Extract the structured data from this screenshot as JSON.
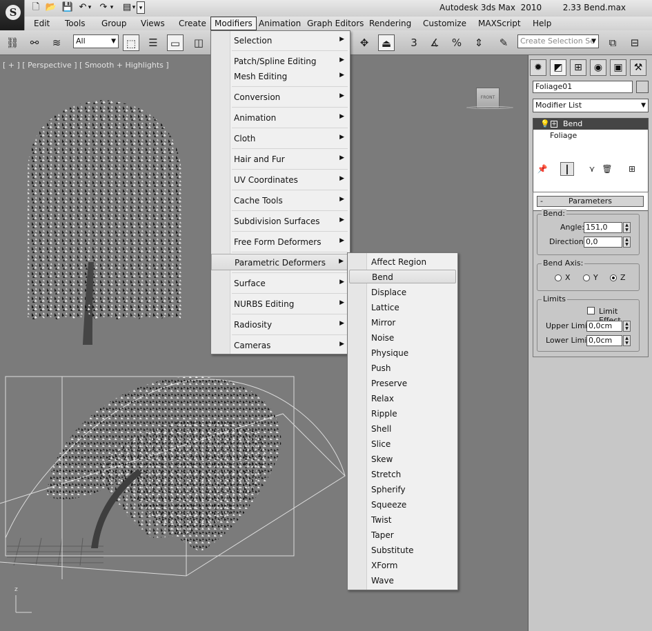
{
  "window": {
    "title": "Autodesk 3ds Max  2010        2.33 Bend.max"
  },
  "quick_access": [
    {
      "name": "new-icon",
      "glyph": "🗋"
    },
    {
      "name": "open-icon",
      "glyph": "📂"
    },
    {
      "name": "save-icon",
      "glyph": "💾"
    },
    {
      "name": "undo-icon",
      "glyph": "↶"
    },
    {
      "name": "undo-dropdown-icon",
      "glyph": "▾"
    },
    {
      "name": "redo-icon",
      "glyph": "↷"
    },
    {
      "name": "redo-dropdown-icon",
      "glyph": "▾"
    },
    {
      "name": "project-icon",
      "glyph": "▤"
    },
    {
      "name": "project-dropdown-icon",
      "glyph": "▾"
    },
    {
      "name": "customize-dropdown-icon",
      "glyph": "▾"
    }
  ],
  "menubar": {
    "items": [
      "Edit",
      "Tools",
      "Group",
      "Views",
      "Create",
      "Modifiers",
      "Animation",
      "Graph Editors",
      "Rendering",
      "Customize",
      "MAXScript",
      "Help"
    ],
    "active": "Modifiers"
  },
  "toolbar": {
    "filter_value": "All",
    "selection_set_placeholder": "Create Selection Se",
    "icons": [
      "link-icon",
      "unlink-icon",
      "bind-space-warp-icon",
      "select-object-icon",
      "select-by-name-icon",
      "rectangular-selection-icon",
      "window-crossing-icon",
      "select-and-move-icon",
      "use-pivot-icon",
      "snaps-toggle-icon",
      "angle-snap-icon",
      "percent-snap-icon",
      "spinner-snap-icon",
      "edit-named-selections-icon",
      "mirror-icon",
      "align-icon"
    ]
  },
  "viewport": {
    "label": "[ + ] [ Perspective ] [ Smooth + Highlights ]",
    "viewcube_label": "FRONT",
    "axis_label": "z"
  },
  "modifiers_menu": [
    {
      "label": "Selection",
      "submenu": true
    },
    {
      "label": "Patch/Spline Editing",
      "submenu": true
    },
    {
      "label": "Mesh Editing",
      "submenu": true
    },
    {
      "label": "Conversion",
      "submenu": true
    },
    {
      "label": "Animation",
      "submenu": true
    },
    {
      "label": "Cloth",
      "submenu": true
    },
    {
      "label": "Hair and Fur",
      "submenu": true
    },
    {
      "label": "UV Coordinates",
      "submenu": true
    },
    {
      "label": "Cache Tools",
      "submenu": true
    },
    {
      "label": "Subdivision Surfaces",
      "submenu": true
    },
    {
      "label": "Free Form Deformers",
      "submenu": true
    },
    {
      "label": "Parametric Deformers",
      "submenu": true,
      "highlighted": true
    },
    {
      "label": "Surface",
      "submenu": true
    },
    {
      "label": "NURBS Editing",
      "submenu": true
    },
    {
      "label": "Radiosity",
      "submenu": true
    },
    {
      "label": "Cameras",
      "submenu": true
    }
  ],
  "parametric_deformers_menu": {
    "items": [
      "Affect Region",
      "Bend",
      "Displace",
      "Lattice",
      "Mirror",
      "Noise",
      "Physique",
      "Push",
      "Preserve",
      "Relax",
      "Ripple",
      "Shell",
      "Slice",
      "Skew",
      "Stretch",
      "Spherify",
      "Squeeze",
      "Twist",
      "Taper",
      "Substitute",
      "XForm",
      "Wave"
    ],
    "highlighted": "Bend"
  },
  "command_panel": {
    "tabs": [
      "create-tab-icon",
      "modify-tab-icon",
      "hierarchy-tab-icon",
      "motion-tab-icon",
      "display-tab-icon",
      "utilities-tab-icon"
    ],
    "object_name": "Foliage01",
    "modifier_list": "Modifier List",
    "stack": [
      {
        "label": "Bend",
        "selected": true
      },
      {
        "label": "Foliage",
        "selected": false
      }
    ],
    "parameters": {
      "title": "Parameters",
      "bend_group": "Bend:",
      "angle_label": "Angle:",
      "angle_value": "151,0",
      "direction_label": "Direction:",
      "direction_value": "0,0",
      "axis_group": "Bend Axis:",
      "axes": [
        "X",
        "Y",
        "Z"
      ],
      "selected_axis": "Z",
      "limits_group": "Limits",
      "limit_effect_label": "Limit Effect",
      "limit_effect_checked": false,
      "upper_label": "Upper Limit:",
      "upper_value": "0,0cm",
      "lower_label": "Lower Limit:",
      "lower_value": "0,0cm"
    }
  }
}
